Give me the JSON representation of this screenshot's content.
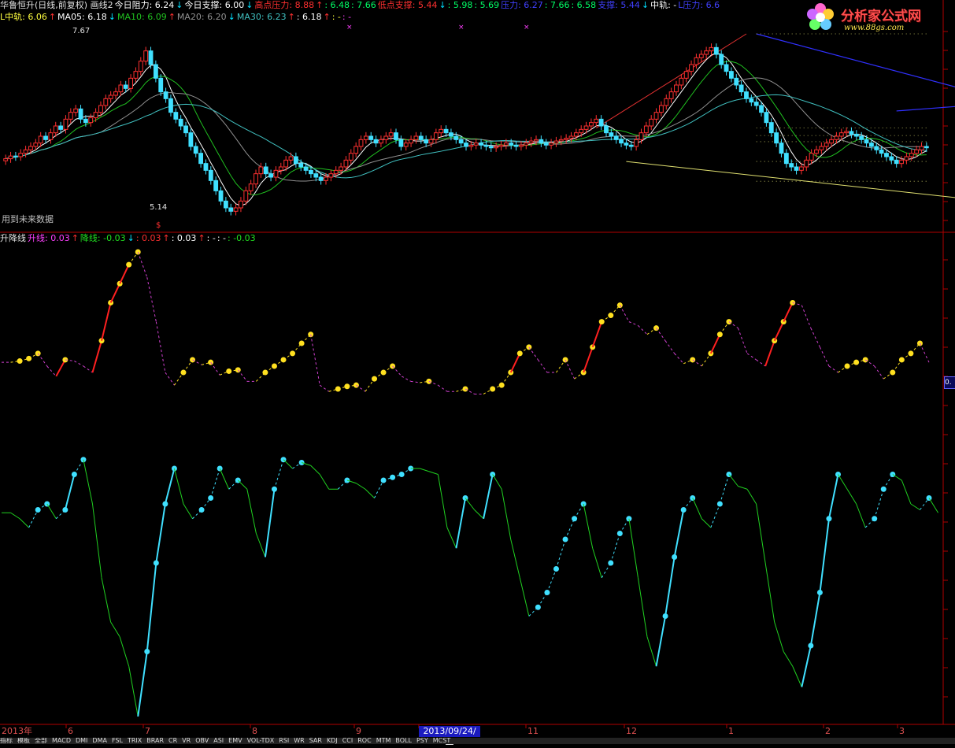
{
  "header": {
    "row1": [
      {
        "text": "华鲁恒升(日线,前复权) 画线2",
        "color": "#e0e0e0"
      },
      {
        "text": "今日阻力: 6.24",
        "color": "#ffffff"
      },
      {
        "text": "↓",
        "color": "#00e0ff"
      },
      {
        "text": "今日支撑: 6.00",
        "color": "#ffffff"
      },
      {
        "text": "↓",
        "color": "#00e0ff"
      },
      {
        "text": "高点压力: 8.88",
        "color": "#ff3030"
      },
      {
        "text": "↑",
        "color": "#ff3030"
      },
      {
        "text": ": 6.48",
        "color": "#00ff66"
      },
      {
        "text": ": 7.66",
        "color": "#00ff66"
      },
      {
        "text": "低点支撑: 5.44",
        "color": "#ff3030"
      },
      {
        "text": "↓",
        "color": "#00e0ff"
      },
      {
        "text": ": 5.98",
        "color": "#00ff66"
      },
      {
        "text": ": 5.69",
        "color": "#00ff66"
      },
      {
        "text": "压力: 6.27",
        "color": "#4040ff"
      },
      {
        "text": ": 7.66",
        "color": "#00ff66"
      },
      {
        "text": ": 6.58",
        "color": "#00ff66"
      },
      {
        "text": "支撑: 5.44",
        "color": "#4040ff"
      },
      {
        "text": "↓",
        "color": "#00e0ff"
      },
      {
        "text": "中轨: -",
        "color": "#ffffff"
      },
      {
        "text": "L压力: 6.6",
        "color": "#4040ff"
      }
    ],
    "row2": [
      {
        "text": "L中轨: 6.06",
        "color": "#ffff40"
      },
      {
        "text": "↑",
        "color": "#ff3030"
      },
      {
        "text": "MA05: 6.18",
        "color": "#ffffff"
      },
      {
        "text": "↓",
        "color": "#00e0ff"
      },
      {
        "text": "MA10: 6.09",
        "color": "#20c020"
      },
      {
        "text": "↑",
        "color": "#ff3030"
      },
      {
        "text": "MA20: 6.20",
        "color": "#909090"
      },
      {
        "text": "↓",
        "color": "#00e0ff"
      },
      {
        "text": "MA30: 6.23",
        "color": "#40c0c0"
      },
      {
        "text": "↑",
        "color": "#ff3030"
      },
      {
        "text": ": 6.18",
        "color": "#ffffff"
      },
      {
        "text": "↑",
        "color": "#ff3030"
      },
      {
        "text": ": -",
        "color": "#ffff40"
      },
      {
        "text": ": -",
        "color": "#ff40ff"
      }
    ],
    "row3": [
      {
        "text": "升降线",
        "color": "#e0e0e0"
      },
      {
        "text": "升线: 0.03",
        "color": "#ff40ff"
      },
      {
        "text": "↑",
        "color": "#ff3030"
      },
      {
        "text": "降线: -0.03",
        "color": "#20e020"
      },
      {
        "text": "↓",
        "color": "#00e0ff"
      },
      {
        "text": ": 0.03",
        "color": "#ff3030"
      },
      {
        "text": "↑",
        "color": "#ff3030"
      },
      {
        "text": ": 0.03",
        "color": "#ffffff"
      },
      {
        "text": "↑",
        "color": "#ff3030"
      },
      {
        "text": ": -",
        "color": "#ffffff"
      },
      {
        "text": ": -",
        "color": "#ffffff"
      },
      {
        "text": ": -0.03",
        "color": "#20e020"
      }
    ]
  },
  "logo": {
    "text": "分析家公式网",
    "url": "www.88gs.com"
  },
  "note": "用到未来数据",
  "right_badge": "0.",
  "price_labels": {
    "high": "7.67",
    "low": "5.14",
    "low_marker": "$"
  },
  "xaxis": {
    "labels": [
      {
        "text": "2013年",
        "x": 2
      },
      {
        "text": "6",
        "x": 86
      },
      {
        "text": "7",
        "x": 184
      },
      {
        "text": "8",
        "x": 320
      },
      {
        "text": "9",
        "x": 452
      },
      {
        "text": "11",
        "x": 670
      },
      {
        "text": "12",
        "x": 795
      },
      {
        "text": "1",
        "x": 925
      },
      {
        "text": "2",
        "x": 1048
      },
      {
        "text": "3",
        "x": 1142
      }
    ],
    "selected": "2013/09/24/二"
  },
  "tabs": [
    "指标",
    "模板",
    "全部",
    "MACD",
    "DMI",
    "DMA",
    "FSL",
    "TRIX",
    "BRAR",
    "CR",
    "VR",
    "OBV",
    "ASI",
    "EMV",
    "VOL-TDX",
    "RSI",
    "WR",
    "SAR",
    "KDJ",
    "CCI",
    "ROC",
    "MTM",
    "BOLL",
    "PSY",
    "MCST"
  ],
  "chart_data": [
    {
      "type": "candlestick",
      "title": "华鲁恒升(日线,前复权)",
      "ylim": [
        5.0,
        8.0
      ],
      "price_high": 7.67,
      "price_low": 5.14,
      "close": [
        6.02,
        6.06,
        6.05,
        6.1,
        6.15,
        6.2,
        6.25,
        6.35,
        6.3,
        6.4,
        6.5,
        6.45,
        6.6,
        6.7,
        6.75,
        6.6,
        6.55,
        6.62,
        6.7,
        6.8,
        6.9,
        6.95,
        7.0,
        7.1,
        7.05,
        7.2,
        7.3,
        7.45,
        7.6,
        7.4,
        7.2,
        7.0,
        6.9,
        6.7,
        6.6,
        6.5,
        6.4,
        6.2,
        6.1,
        5.95,
        5.85,
        5.7,
        5.55,
        5.4,
        5.3,
        5.25,
        5.3,
        5.4,
        5.55,
        5.65,
        5.8,
        5.9,
        5.8,
        5.75,
        5.85,
        5.9,
        6.0,
        6.05,
        5.95,
        5.9,
        5.85,
        5.8,
        5.75,
        5.7,
        5.75,
        5.8,
        5.85,
        5.9,
        6.0,
        6.1,
        6.2,
        6.3,
        6.35,
        6.3,
        6.25,
        6.3,
        6.35,
        6.4,
        6.3,
        6.2,
        6.25,
        6.3,
        6.35,
        6.3,
        6.25,
        6.3,
        6.4,
        6.45,
        6.4,
        6.35,
        6.3,
        6.25,
        6.2,
        6.22,
        6.25,
        6.22,
        6.2,
        6.18,
        6.2,
        6.22,
        6.25,
        6.22,
        6.2,
        6.22,
        6.25,
        6.28,
        6.3,
        6.25,
        6.22,
        6.25,
        6.28,
        6.3,
        6.32,
        6.35,
        6.4,
        6.45,
        6.5,
        6.55,
        6.6,
        6.5,
        6.4,
        6.35,
        6.3,
        6.25,
        6.22,
        6.2,
        6.3,
        6.4,
        6.5,
        6.6,
        6.7,
        6.8,
        6.9,
        7.0,
        7.1,
        7.2,
        7.3,
        7.4,
        7.5,
        7.55,
        7.6,
        7.65,
        7.55,
        7.4,
        7.3,
        7.2,
        7.1,
        7.0,
        6.9,
        6.85,
        6.8,
        6.7,
        6.55,
        6.4,
        6.25,
        6.1,
        5.95,
        5.9,
        5.85,
        5.9,
        6.0,
        6.1,
        6.15,
        6.2,
        6.25,
        6.3,
        6.35,
        6.4,
        6.42,
        6.38,
        6.35,
        6.3,
        6.25,
        6.2,
        6.15,
        6.1,
        6.05,
        6.0,
        5.95,
        6.0,
        6.05,
        6.1,
        6.15,
        6.2,
        6.18
      ]
    },
    {
      "type": "line",
      "title": "升降线",
      "ylim": [
        -0.9,
        0.9
      ],
      "series": [
        {
          "name": "升线",
          "values": [
            0.03,
            0.03,
            0.04,
            0.06,
            0.1,
            0.0,
            -0.08,
            0.05,
            0.04,
            0.0,
            -0.05,
            0.2,
            0.5,
            0.65,
            0.8,
            0.9,
            0.7,
            0.35,
            -0.05,
            -0.15,
            -0.05,
            0.05,
            0.01,
            0.03,
            -0.07,
            -0.04,
            -0.03,
            -0.12,
            -0.12,
            -0.05,
            0.0,
            0.05,
            0.1,
            0.18,
            0.25,
            -0.15,
            -0.2,
            -0.18,
            -0.16,
            -0.15,
            -0.2,
            -0.1,
            -0.05,
            0.0,
            -0.08,
            -0.12,
            -0.13,
            -0.12,
            -0.15,
            -0.2,
            -0.2,
            -0.18,
            -0.22,
            -0.22,
            -0.18,
            -0.15,
            -0.05,
            0.1,
            0.15,
            0.05,
            -0.05,
            -0.05,
            0.05,
            -0.1,
            -0.05,
            0.15,
            0.35,
            0.4,
            0.48,
            0.35,
            0.32,
            0.25,
            0.3,
            0.2,
            0.1,
            0.02,
            0.05,
            0.0,
            0.1,
            0.25,
            0.35,
            0.3,
            0.1,
            0.05,
            0.0,
            0.2,
            0.35,
            0.5,
            0.48,
            0.3,
            0.15,
            0.0,
            -0.05,
            0.0,
            0.03,
            0.05,
            0.0,
            -0.1,
            -0.05,
            0.05,
            0.1,
            0.18,
            0.03
          ]
        },
        {
          "name": "降线",
          "values": [
            -0.03,
            -0.03,
            -0.05,
            -0.08,
            -0.02,
            0.0,
            -0.05,
            -0.02,
            0.1,
            0.15,
            0.0,
            -0.25,
            -0.4,
            -0.45,
            -0.55,
            -0.72,
            -0.5,
            -0.2,
            0.0,
            0.12,
            0.0,
            -0.05,
            -0.02,
            0.02,
            0.12,
            0.05,
            0.08,
            0.05,
            -0.1,
            -0.18,
            0.05,
            0.15,
            0.12,
            0.14,
            0.13,
            0.1,
            0.05,
            0.05,
            0.08,
            0.07,
            0.05,
            0.02,
            0.08,
            0.09,
            0.1,
            0.12,
            0.12,
            0.11,
            0.1,
            -0.08,
            -0.15,
            0.02,
            -0.02,
            -0.05,
            0.1,
            0.05,
            -0.12,
            -0.25,
            -0.38,
            -0.35,
            -0.3,
            -0.22,
            -0.12,
            -0.05,
            0.0,
            -0.15,
            -0.25,
            -0.2,
            -0.1,
            -0.05,
            -0.25,
            -0.45,
            -0.55,
            -0.38,
            -0.18,
            -0.02,
            0.02,
            -0.05,
            -0.08,
            0.0,
            0.1,
            0.06,
            0.05,
            0.0,
            -0.2,
            -0.4,
            -0.5,
            -0.55,
            -0.62,
            -0.48,
            -0.3,
            -0.05,
            0.1,
            0.05,
            0.0,
            -0.08,
            -0.05,
            0.05,
            0.1,
            0.08,
            0.0,
            -0.02,
            0.02,
            -0.03
          ]
        }
      ]
    }
  ]
}
